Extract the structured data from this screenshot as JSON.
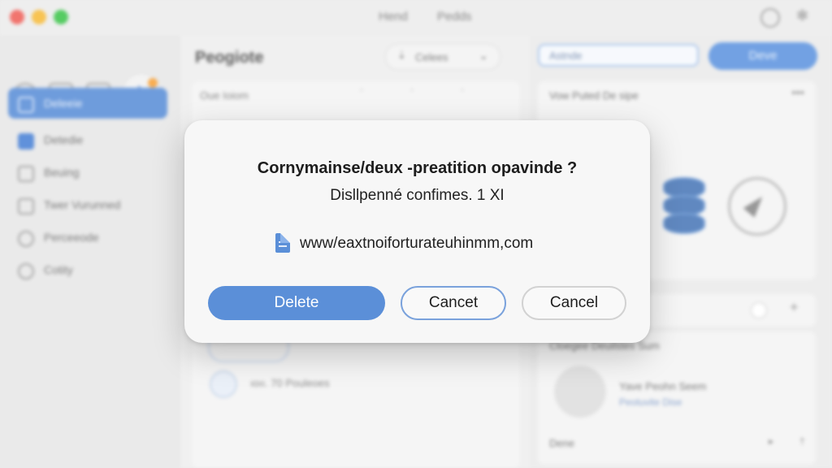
{
  "window": {
    "menu": [
      "Hend",
      "Pedds"
    ]
  },
  "sidebar": {
    "items": [
      {
        "label": "Deleeie",
        "active": true
      },
      {
        "label": "Detedie",
        "checked": true
      },
      {
        "label": "Beuing"
      },
      {
        "label": "Twer Vurunned"
      },
      {
        "label": "Perceeode"
      },
      {
        "label": "Cotity"
      }
    ]
  },
  "main": {
    "title": "Peogiote",
    "filter": {
      "label": "Celees"
    },
    "list_header": "Oue Ioiom",
    "list_row_text": "ıoıı. 70 Pouleoes"
  },
  "right": {
    "search": {
      "value": "Astnde"
    },
    "done_label": "Deve",
    "card1_title": "Vow Puted De sipe",
    "card2_title": "Cloegee Deuilstes Sum",
    "file_title": "Yave Peohn Seem",
    "file_sub": "Peotuvite Dise",
    "footer": "Dene"
  },
  "dialog": {
    "title": "Cornymainse/deux -preatition opavinde ?",
    "subtitle": "Disllpenné confimes. 1 XI",
    "file_url": "www/eaxtnoiforturateuhinmm,com",
    "delete_label": "Delete",
    "cancel_label": "Cancet",
    "cancel2_label": "Cancel"
  },
  "colors": {
    "accent": "#5b8fd8",
    "delete_button": "#5b8fd8"
  }
}
